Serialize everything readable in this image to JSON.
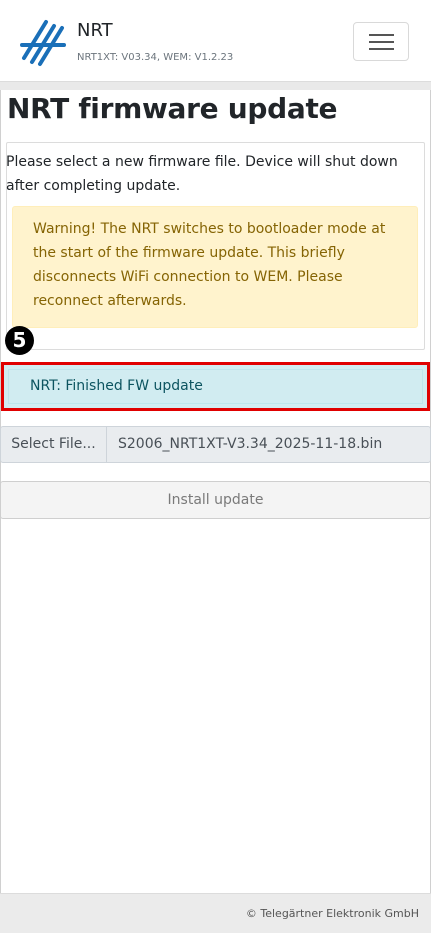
{
  "header": {
    "brand_name": "NRT",
    "version": "NRT1XT: V03.34, WEM: V1.2.23",
    "logo_icon": "nrt-logo-icon",
    "menu_icon": "hamburger-menu-icon",
    "logo_color": "#1a6fb8"
  },
  "page": {
    "title": "NRT firmware update",
    "instructions": "Please select a new firmware file. Device will shut down after completing update.",
    "warning": "Warning! The NRT switches to bootloader mode at the start of the firmware update. This briefly disconnects WiFi connection to WEM. Please reconnect afterwards.",
    "step_marker": "5",
    "status": "NRT: Finished FW update"
  },
  "upload": {
    "select_label": "Select File...",
    "file_name": "S2006_NRT1XT-V3.34_2025-11-18.bin",
    "install_label": "Install update"
  },
  "footer": {
    "copyright": "© Telegärtner Elektronik GmbH"
  },
  "colors": {
    "warning_bg": "#fff3cd",
    "warning_text": "#856404",
    "status_bg": "#d1ecf1",
    "status_text": "#0c5460",
    "highlight_border": "#e00000"
  }
}
